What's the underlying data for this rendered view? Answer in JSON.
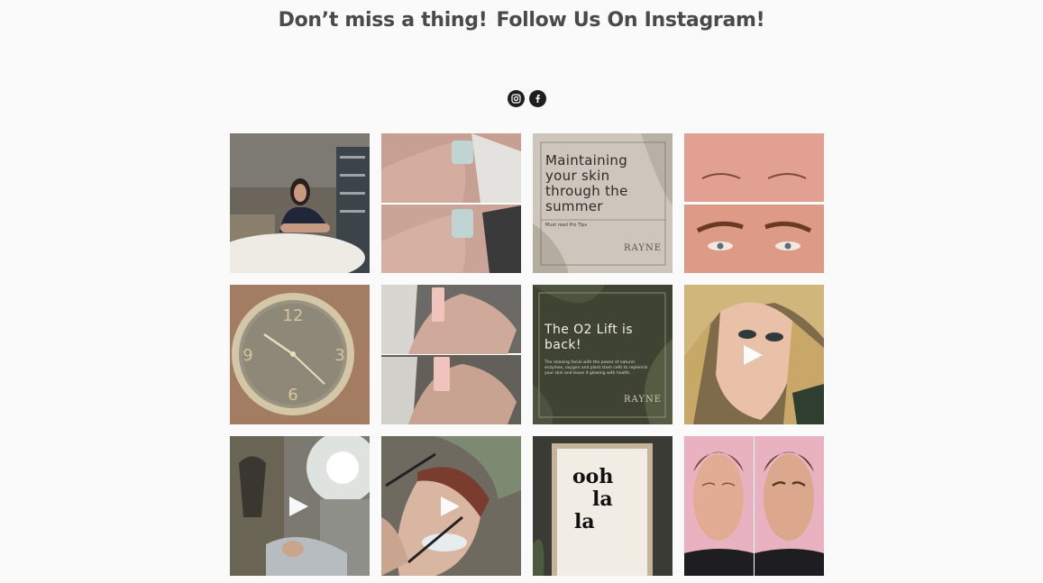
{
  "header": {
    "title_part1": "Don’t miss a thing!",
    "title_part2": "Follow Us On Instagram!"
  },
  "social": [
    {
      "name": "instagram-icon"
    },
    {
      "name": "facebook-icon"
    }
  ],
  "posts": [
    {
      "kind": "photo",
      "subject": "woman seated by treatment bed"
    },
    {
      "kind": "photo",
      "subject": "before and after facial profile"
    },
    {
      "kind": "graphic",
      "title": "Maintaining your skin through the summer",
      "subtitle": "Must read Pro Tips",
      "logo": "RAYNE"
    },
    {
      "kind": "photo",
      "subject": "brow before and after"
    },
    {
      "kind": "photo",
      "subject": "gold wall clock"
    },
    {
      "kind": "photo",
      "subject": "before and after facial"
    },
    {
      "kind": "graphic",
      "title": "The O2 Lift is back!",
      "body": "The relaxing facial with the power of natural enzymes, oxygen and plant stem cells to replenish your skin and leave it glowing with health.",
      "logo": "RAYNE"
    },
    {
      "kind": "video",
      "subject": "woman with lash extensions"
    },
    {
      "kind": "video",
      "subject": "treatment room with light"
    },
    {
      "kind": "video",
      "subject": "lash application"
    },
    {
      "kind": "photo",
      "subject": "framed poster",
      "poster_text": [
        "ooh",
        "la",
        "la"
      ]
    },
    {
      "kind": "photo",
      "subject": "brow tint before and after"
    }
  ],
  "colors": {
    "heading": "#4a4a4a",
    "icon_bg": "#1e1e1e",
    "page_bg": "#fafafa"
  }
}
